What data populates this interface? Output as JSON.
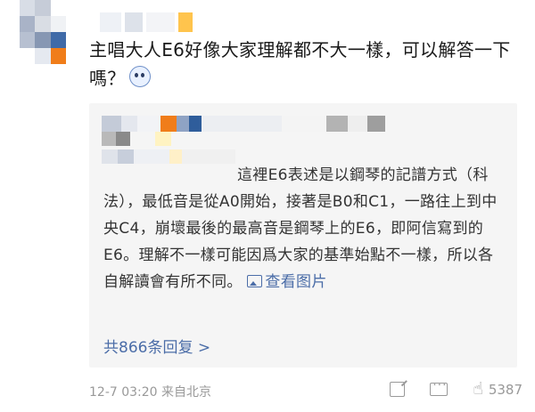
{
  "comment": {
    "text": "主唱大人E6好像大家理解都不大一樣，可以解答一下嗎？"
  },
  "reply": {
    "text_part1": "這裡E6表述是以鋼琴的記譜方式（科法），最低音是從A0開始，接著是B0和C1，一路往上到中央C4，崩壞最後的最高音是鋼琴上的E6，即阿信寫到的E6。理解不一樣可能因爲大家的基準始點不一樣，所以各自解讀會有所不同。",
    "view_image_label": "查看图片",
    "total_replies_label": "共866条回复 >"
  },
  "footer": {
    "meta": "12-7 03:20  来自北京",
    "like_count": "5387"
  },
  "icons": {
    "emoji": "confused-face-icon",
    "image": "image-icon",
    "share": "share-icon",
    "comment": "comment-icon",
    "like": "thumbs-up-icon"
  },
  "colors": {
    "link": "#4b6da8",
    "reply_bg": "#f5f5f5",
    "meta_gray": "#999999"
  }
}
